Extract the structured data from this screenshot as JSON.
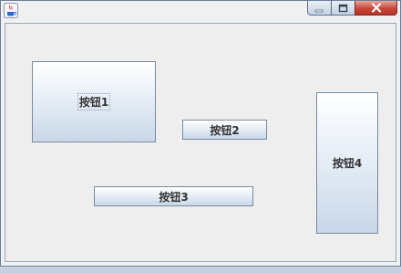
{
  "window": {
    "title": "",
    "controls": {
      "minimize_icon": "minimize-icon",
      "maximize_icon": "maximize-icon",
      "close_icon": "close-icon"
    },
    "colors": {
      "close_button": "#c8473a",
      "client_background": "#eeeeee"
    }
  },
  "buttons": {
    "button1": {
      "label": "按钮1",
      "focused": true
    },
    "button2": {
      "label": "按钮2"
    },
    "button3": {
      "label": "按钮3"
    },
    "button4": {
      "label": "按钮4"
    }
  }
}
